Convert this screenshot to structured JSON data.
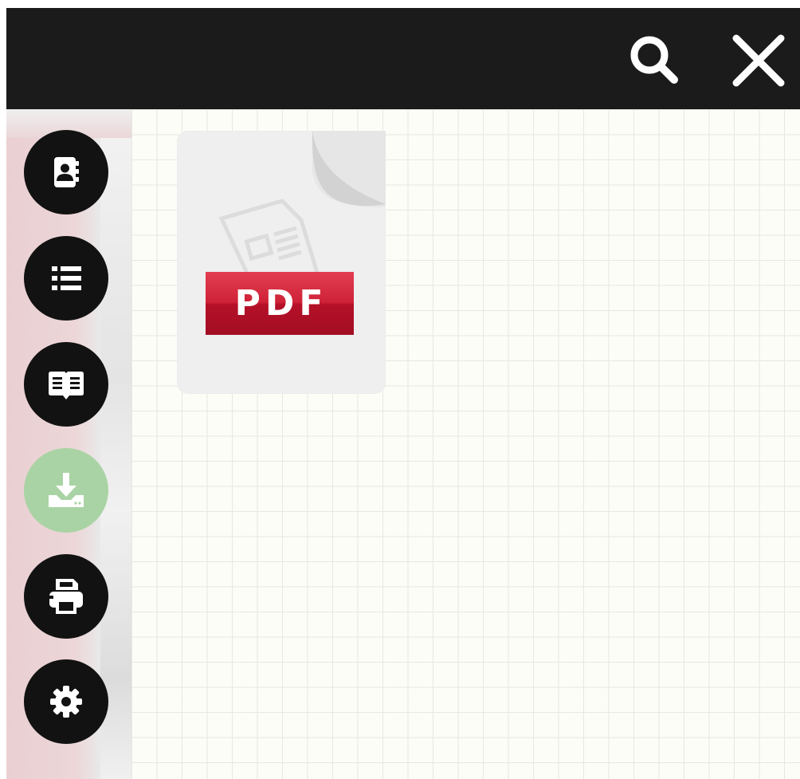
{
  "topbar": {
    "search_icon": "search-icon",
    "close_icon": "close-icon"
  },
  "sidebar": {
    "buttons": [
      {
        "name": "contacts",
        "icon": "contact-book-icon",
        "active": false
      },
      {
        "name": "list",
        "icon": "list-icon",
        "active": false
      },
      {
        "name": "reader",
        "icon": "open-book-icon",
        "active": false
      },
      {
        "name": "download",
        "icon": "download-icon",
        "active": true
      },
      {
        "name": "print",
        "icon": "printer-icon",
        "active": false
      },
      {
        "name": "settings",
        "icon": "gear-icon",
        "active": false
      }
    ]
  },
  "content": {
    "file": {
      "label": "PDF",
      "icon": "pdf-file-icon"
    }
  },
  "colors": {
    "topbar": "#1b1b1b",
    "button": "#121212",
    "active_button": "#a9d3a4",
    "pdf_red": "#c8162e",
    "grid_background": "#fdfdf8"
  }
}
